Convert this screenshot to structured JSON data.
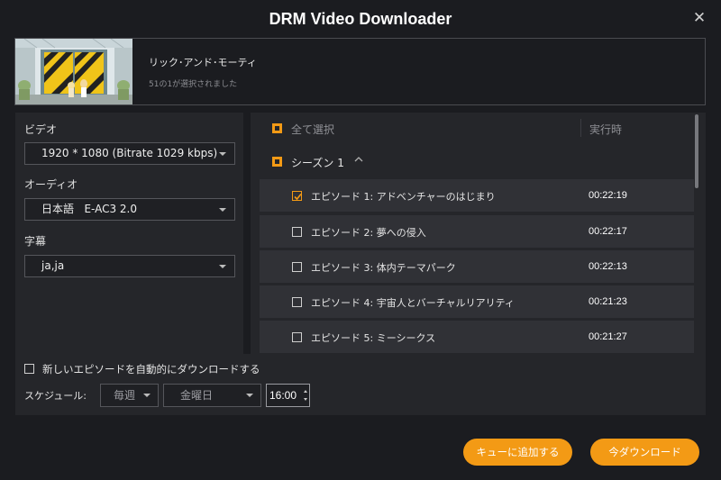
{
  "window": {
    "title": "DRM Video Downloader"
  },
  "show": {
    "title": "リック･アンド･モーティ",
    "selected_count": "51の1が選択されました"
  },
  "settings": {
    "video_label": "ビデオ",
    "video_value": "1920 * 1080 (Bitrate 1029 kbps)",
    "audio_label": "オーディオ",
    "audio_value": "日本語   E-AC3 2.0",
    "subtitle_label": "字幕",
    "subtitle_value": "ja,ja"
  },
  "episode_list": {
    "select_all_label": "全て選択",
    "duration_header": "実行時",
    "season_label": "シーズン 1",
    "episodes": [
      {
        "title": "エピソード 1: アドベンチャーのはじまり",
        "duration": "00:22:19",
        "checked": true
      },
      {
        "title": "エピソード 2: 夢への侵入",
        "duration": "00:22:17",
        "checked": false
      },
      {
        "title": "エピソード 3: 体内テーマパーク",
        "duration": "00:22:13",
        "checked": false
      },
      {
        "title": "エピソード 4: 宇宙人とバーチャルリアリティ",
        "duration": "00:21:23",
        "checked": false
      },
      {
        "title": "エピソード 5: ミーシークス",
        "duration": "00:21:27",
        "checked": false
      }
    ]
  },
  "schedule": {
    "auto_download_label": "新しいエピソードを自動的にダウンロードする",
    "schedule_label": "スケジュール:",
    "frequency": "毎週",
    "weekday": "金曜日",
    "time": "16:00"
  },
  "actions": {
    "add_to_queue": "キューに追加する",
    "download_now": "今ダウンロード"
  },
  "colors": {
    "accent": "#f39a15",
    "background": "#1b1c20",
    "panel": "#25262a",
    "row": "#303136"
  }
}
